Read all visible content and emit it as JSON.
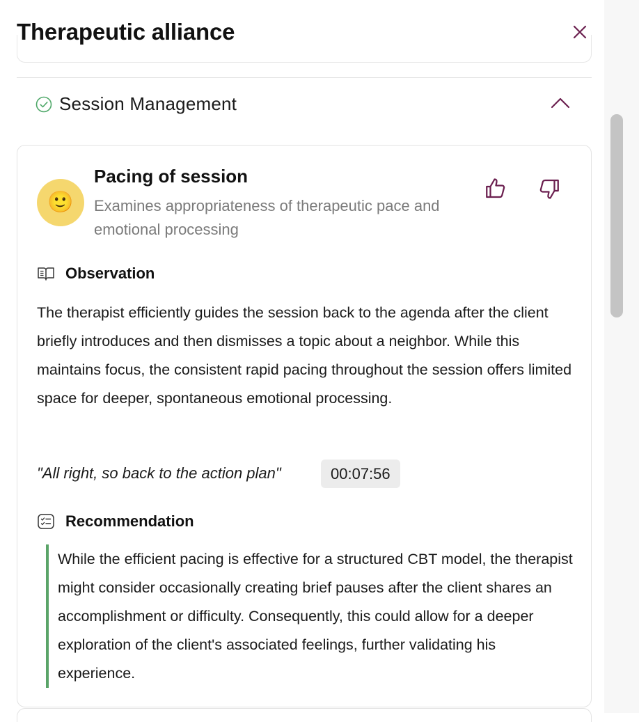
{
  "panel": {
    "title": "Therapeutic alliance",
    "close_icon": "close-icon"
  },
  "section": {
    "title": "Session Management",
    "status_icon": "check-circle-icon",
    "expanded": true
  },
  "metric": {
    "emoji": "🙂",
    "title": "Pacing of session",
    "description": "Examines appropriateness of therapeutic pace and emotional processing",
    "feedback": {
      "up_icon": "thumbs-up-icon",
      "down_icon": "thumbs-down-icon"
    }
  },
  "observation": {
    "heading": "Observation",
    "text": "The therapist efficiently guides the session back to the agenda after the client briefly introduces and then dismisses a topic about a neighbor. While this maintains focus, the consistent rapid pacing throughout the session offers limited space for deeper, spontaneous emotional processing.",
    "quote": "\"All right, so back to the action plan\"",
    "timestamp": "00:07:56"
  },
  "recommendation": {
    "heading": "Recommendation",
    "text": "While the efficient pacing is effective for a structured CBT model, the therapist might consider occasionally creating brief pauses after the client shares an accomplishment or difficulty. Consequently, this could allow for a deeper exploration of the client's associated feelings, further validating his experience."
  },
  "colors": {
    "accent": "#6b1f4f",
    "success": "#4fa869",
    "emoji_bg": "#f5d76e",
    "timestamp_bg": "#ececec"
  }
}
